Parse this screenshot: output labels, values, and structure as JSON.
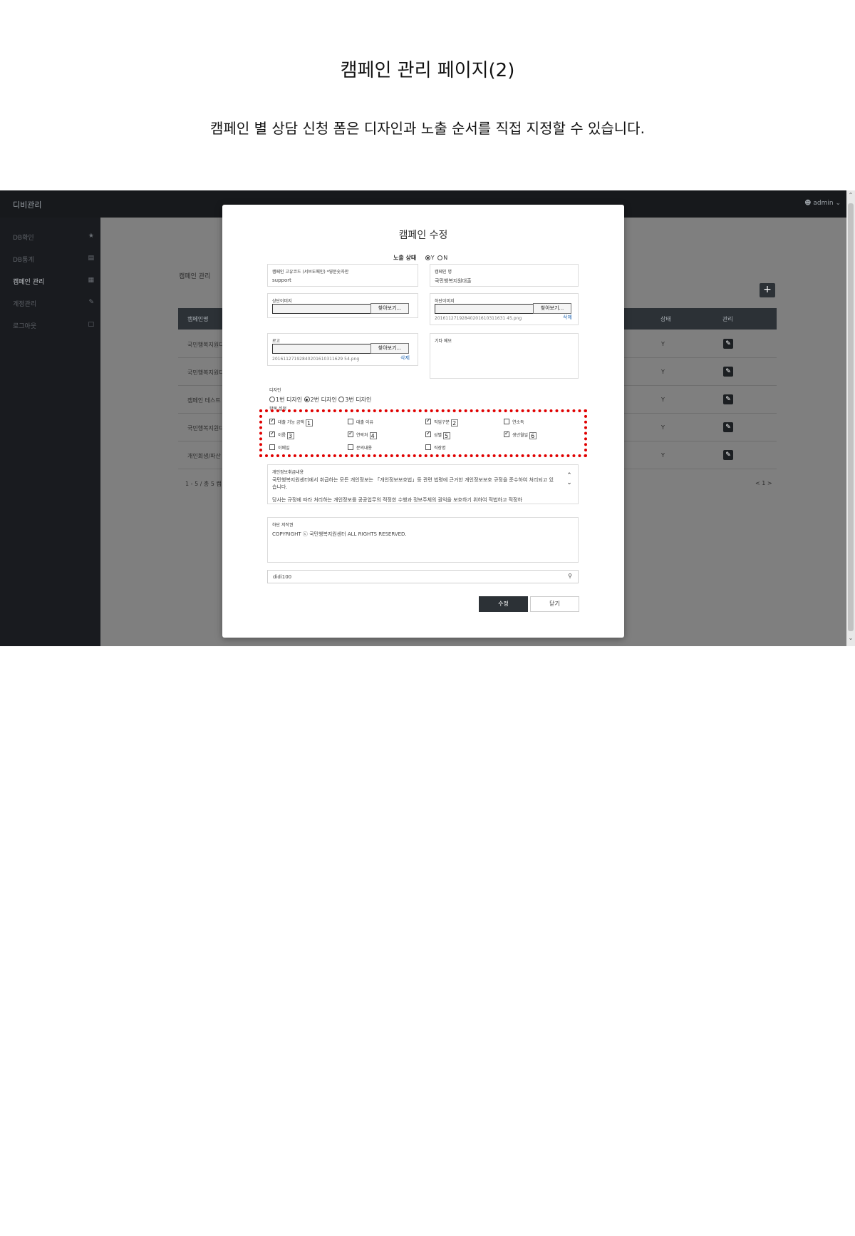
{
  "doc": {
    "title": "캠페인 관리 페이지(2)",
    "subtitle": "캠페인 별 상담 신청 폼은 디자인과 노출 순서를 직접 지정할 수 있습니다."
  },
  "app": {
    "brand": "디비관리",
    "user": "admin"
  },
  "sidebar": {
    "items": [
      {
        "label": "DB확인",
        "icon": "dashboard-icon"
      },
      {
        "label": "DB통계",
        "icon": "bar-chart-icon"
      },
      {
        "label": "캠페인 관리",
        "icon": "grid-icon"
      },
      {
        "label": "계정관리",
        "icon": "edit-icon"
      },
      {
        "label": "로그아웃",
        "icon": "monitor-icon"
      }
    ]
  },
  "main": {
    "title": "캠페인 관리",
    "add_button": "+",
    "columns": [
      "캠페인명",
      "상태",
      "관리"
    ],
    "rows": [
      {
        "name": "국민행복지원디",
        "status": "Y"
      },
      {
        "name": "국민행복지원디",
        "status": "Y"
      },
      {
        "name": "캠페인 테스트",
        "status": "Y"
      },
      {
        "name": "국민행복지원디",
        "status": "Y"
      },
      {
        "name": "개인회생/파산",
        "status": "Y"
      }
    ],
    "paging_info": "1 - 5 / 총 5 캠",
    "pager": "< 1 >"
  },
  "modal": {
    "title": "캠페인 수정",
    "exposure_label": "노출 상태",
    "exposure_yes": "Y",
    "exposure_no": "N",
    "code_label": "캠페인 고유코드 (서브도메인) *영문숫자만",
    "code_value": "support",
    "name_label": "캠페인 명",
    "name_value": "국민행복지원대출",
    "top_image_label": "상단이미지",
    "bottom_image_label": "하단이미지",
    "find_button": "찾아보기...",
    "bottom_image_file": "20161127192840201610311631 45.png",
    "delete_label": "삭제",
    "logo_label": "로고",
    "logo_file": "20161127192840201610311629 54.png",
    "memo_label": "기타 메모",
    "design_label": "디자인",
    "design_options": [
      "1번 디자인",
      "2번 디자인",
      "3번 디자인"
    ],
    "fields_label": "항목 설정",
    "fields": [
      {
        "label": "대출 가능 금액",
        "checked": true,
        "order": "1"
      },
      {
        "label": "대출 이유",
        "checked": false,
        "order": ""
      },
      {
        "label": "직업구분",
        "checked": true,
        "order": "2"
      },
      {
        "label": "연소득",
        "checked": false,
        "order": ""
      },
      {
        "label": "이름",
        "checked": true,
        "order": "3"
      },
      {
        "label": "연락처",
        "checked": true,
        "order": "4"
      },
      {
        "label": "성별",
        "checked": true,
        "order": "5"
      },
      {
        "label": "생년월일",
        "checked": true,
        "order": "6"
      },
      {
        "label": "이메일",
        "checked": false,
        "order": ""
      },
      {
        "label": "문의내용",
        "checked": false,
        "order": ""
      },
      {
        "label": "직장명",
        "checked": false,
        "order": ""
      }
    ],
    "privacy_label": "개인정보취급내용",
    "privacy_text_1": "국민행복지원센터에서 취급하는 모든 개인정보는 「개인정보보호법」등 관련 법령에 근거한 개인정보보호 규정을 준수하여 처리되고 있습니다.",
    "privacy_text_2": "당사는 규정에 따라 처리하는 개인정보를 공공업무의 적정한 수행과 정보주체의 권익을 보호하기 위하여 적법하고 적정하",
    "copyright_label": "하단 저작권",
    "copyright_text": "COPYRIGHT ⓒ 국민행복지원센터 ALL RIGHTS RESERVED.",
    "search_value": "didi100",
    "save_button": "수정",
    "close_button": "닫기"
  }
}
